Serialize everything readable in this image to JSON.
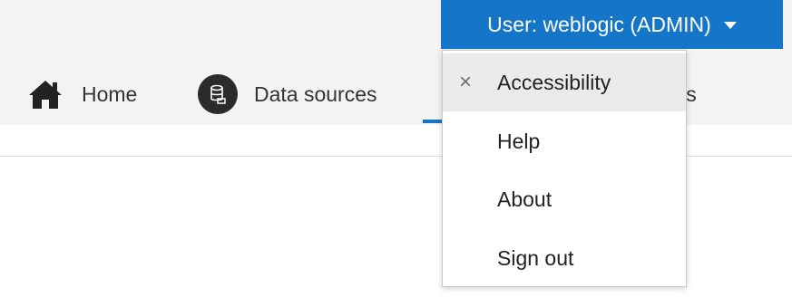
{
  "user_menu": {
    "label": "User: weblogic (ADMIN)",
    "caret_icon": "caret-down-icon",
    "accent_color": "#1576c9"
  },
  "nav": {
    "tabs": [
      {
        "label": "Home",
        "icon": "home-icon"
      },
      {
        "label": "Data sources",
        "icon": "database-icon"
      },
      {
        "label": "ettings",
        "icon": ""
      }
    ]
  },
  "dropdown": {
    "items": [
      {
        "label": "Accessibility",
        "checked_icon": "×",
        "highlighted": true
      },
      {
        "label": "Help"
      },
      {
        "label": "About"
      },
      {
        "label": "Sign out"
      }
    ]
  }
}
